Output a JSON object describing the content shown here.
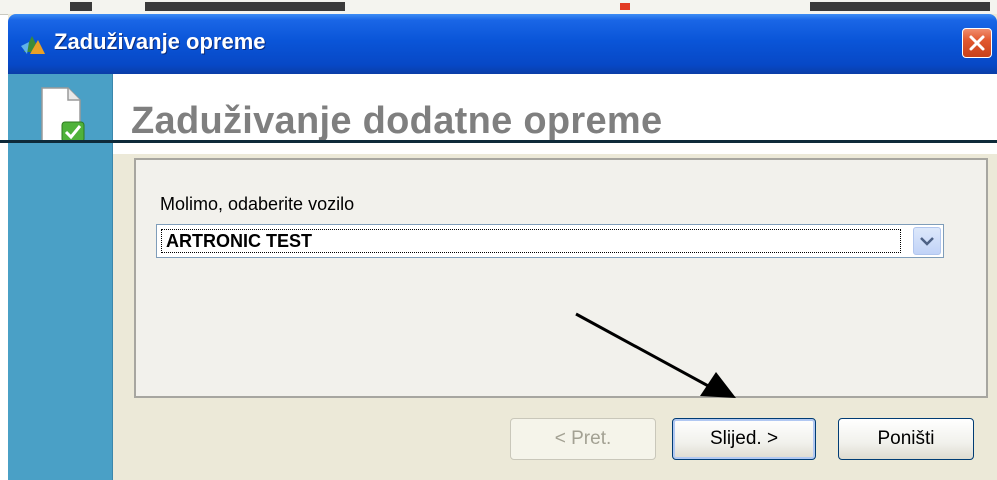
{
  "dialog": {
    "title": "Zaduživanje opreme",
    "close_icon": "close-icon",
    "app_icon": "app-icon"
  },
  "header": {
    "title": "Zaduživanje dodatne opreme",
    "icon": "document-check-icon"
  },
  "form": {
    "vehicle_label": "Molimo, odaberite vozilo",
    "vehicle_selected": "ARTRONIC TEST",
    "dropdown_icon": "chevron-down-icon"
  },
  "buttons": {
    "back_label": "< Pret.",
    "next_label": "Slijed. >",
    "cancel_label": "Poništi"
  },
  "colors": {
    "titlebar": "#0a55d8",
    "left_band": "#4aa0c6",
    "close_button": "#e2582f",
    "header_text": "#7f7f7f"
  }
}
